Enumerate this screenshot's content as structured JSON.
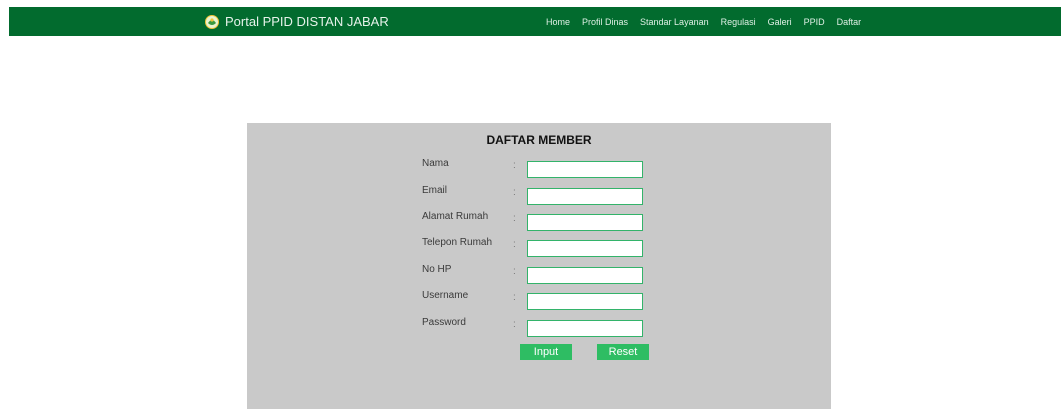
{
  "navbar": {
    "brand": "Portal PPID DISTAN JABAR",
    "logo_icon": "leaf-seal-icon",
    "bg_color": "#026b2e",
    "items": [
      {
        "label": "Home"
      },
      {
        "label": "Profil Dinas"
      },
      {
        "label": "Standar Layanan"
      },
      {
        "label": "Regulasi"
      },
      {
        "label": "Galeri"
      },
      {
        "label": "PPID"
      },
      {
        "label": "Daftar"
      }
    ]
  },
  "form": {
    "title": "DAFTAR MEMBER",
    "separator": ":",
    "fields": [
      {
        "label": "Nama",
        "value": "",
        "placeholder": ""
      },
      {
        "label": "Email",
        "value": "",
        "placeholder": ""
      },
      {
        "label": "Alamat Rumah",
        "value": "",
        "placeholder": ""
      },
      {
        "label": "Telepon Rumah",
        "value": "",
        "placeholder": ""
      },
      {
        "label": "No HP",
        "value": "",
        "placeholder": ""
      },
      {
        "label": "Username",
        "value": "",
        "placeholder": ""
      },
      {
        "label": "Password",
        "value": "",
        "placeholder": ""
      }
    ],
    "buttons": {
      "submit_label": "Input",
      "reset_label": "Reset"
    },
    "accent_color": "#2ebd63",
    "panel_color": "#c9c9c9"
  }
}
